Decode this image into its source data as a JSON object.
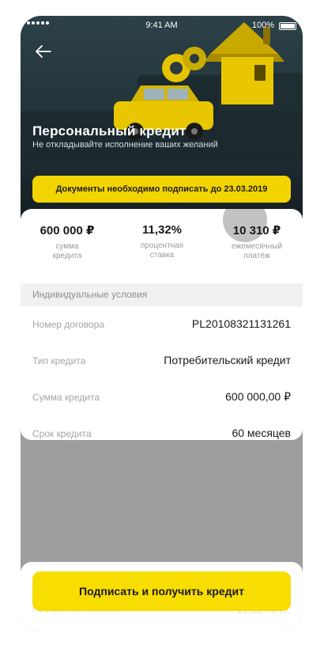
{
  "status_bar": {
    "time": "9:41 AM",
    "battery": "100%"
  },
  "hero": {
    "title": "Персональный кредит",
    "subtitle": "Не откладывайте исполнение ваших желаний",
    "deadline_notice": "Документы необходимо подписать до 23.03.2019"
  },
  "summary": [
    {
      "value": "600 000 ₽",
      "label": "сумма\nкредита"
    },
    {
      "value": "11,32%",
      "label": "процентная\nставка"
    },
    {
      "value": "10 310 ₽",
      "label": "ежемесячный\nплатёж"
    }
  ],
  "conditions": {
    "header": "Индивидуальные условия",
    "rows": [
      {
        "key": "Номер договора",
        "value": "PL20108321131261"
      },
      {
        "key": "Тип кредита",
        "value": "Потребительский кредит"
      },
      {
        "key": "Сумма кредита",
        "value": "600 000,00 ₽"
      },
      {
        "key": "Срок кредита",
        "value": "60 месяцев"
      }
    ],
    "partial_row": {
      "key": "Процентная ставка",
      "value": "11,32 % г.г."
    }
  },
  "action": {
    "sign_label": "Подписать и получить кредит"
  },
  "colors": {
    "accent": "#f8dd00",
    "hero_dark": "#22343a",
    "overlay": "#9e9e9e"
  }
}
